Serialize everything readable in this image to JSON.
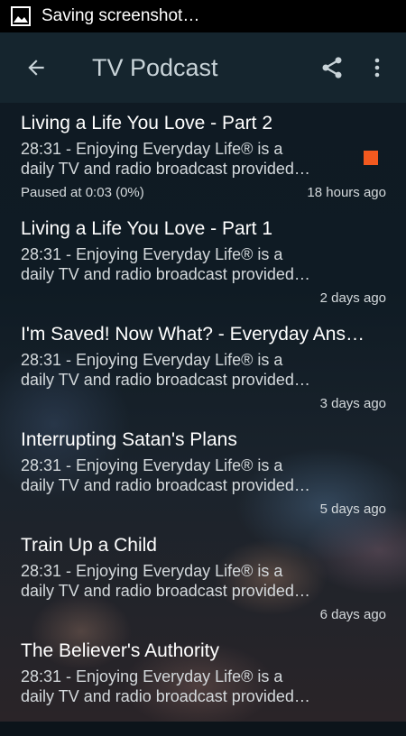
{
  "status_bar": {
    "icon": "image-icon",
    "text": "Saving screenshot…"
  },
  "app_bar": {
    "title": "TV Podcast",
    "back_icon": "arrow-left-icon",
    "share_icon": "share-icon",
    "more_icon": "more-vert-icon"
  },
  "colors": {
    "accent": "#f2591f",
    "app_bar": "#162630"
  },
  "episodes": [
    {
      "title": "Living a Life You Love - Part 2",
      "desc_line1": "28:31 - Enjoying Everyday Life® is a",
      "desc_line2": "daily TV and radio broadcast provided…",
      "status": "Paused at 0:03 (0%)",
      "age": "18 hours ago",
      "playing": true
    },
    {
      "title": "Living a Life You Love - Part 1",
      "desc_line1": "28:31 - Enjoying Everyday Life® is a",
      "desc_line2": "daily TV and radio broadcast provided…",
      "status": "",
      "age": "2 days ago",
      "playing": false
    },
    {
      "title": "I'm Saved! Now What? - Everyday Ans…",
      "desc_line1": "28:31 - Enjoying Everyday Life® is a",
      "desc_line2": "daily TV and radio broadcast provided…",
      "status": "",
      "age": "3 days ago",
      "playing": false
    },
    {
      "title": "Interrupting Satan's Plans",
      "desc_line1": "28:31 - Enjoying Everyday Life® is a",
      "desc_line2": "daily TV and radio broadcast provided…",
      "status": "",
      "age": "5 days ago",
      "playing": false
    },
    {
      "title": "Train Up a Child",
      "desc_line1": "28:31 - Enjoying Everyday Life® is a",
      "desc_line2": "daily TV and radio broadcast provided…",
      "status": "",
      "age": "6 days ago",
      "playing": false
    },
    {
      "title": "The Believer's Authority",
      "desc_line1": "28:31 - Enjoying Everyday Life® is a",
      "desc_line2": "daily TV and radio broadcast provided…",
      "status": "",
      "age": "",
      "playing": false
    }
  ]
}
